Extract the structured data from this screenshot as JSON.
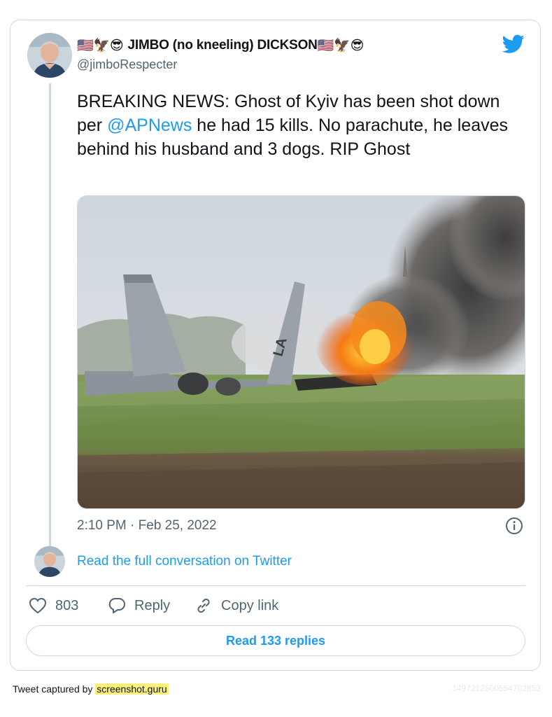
{
  "tweet": {
    "author": {
      "display_name": "JIMBO (no kneeling) DICKSON",
      "leading_emojis": "🇺🇸🦅😎",
      "trailing_emojis": "🇺🇸🦅😎",
      "handle": "@jimboRespecter",
      "avatar_icon": "avatar-photo"
    },
    "text": {
      "part1": "BREAKING NEWS: Ghost of Kyiv has been shot down per ",
      "mention": "@APNews",
      "part2": " he had 15 kills. No parachute, he leaves behind his husband and 3 dogs. RIP Ghost"
    },
    "media": {
      "image_icon": "crashed-jet-photo"
    },
    "timestamp": "2:10 PM · Feb 25, 2022",
    "read_conversation": "Read the full conversation on Twitter",
    "actions": {
      "like_count": "803",
      "reply_label": "Reply",
      "copy_link_label": "Copy link"
    },
    "read_replies": "Read 133 replies"
  },
  "footer": {
    "captured_by": "Tweet captured by ",
    "site": "screenshot.guru",
    "tweet_id": "1497212500554702853"
  },
  "colors": {
    "accent": "#1d9bf0",
    "text": "#0f1419",
    "muted": "#536471",
    "border": "#cfd9de",
    "highlight": "#fdf07a"
  }
}
